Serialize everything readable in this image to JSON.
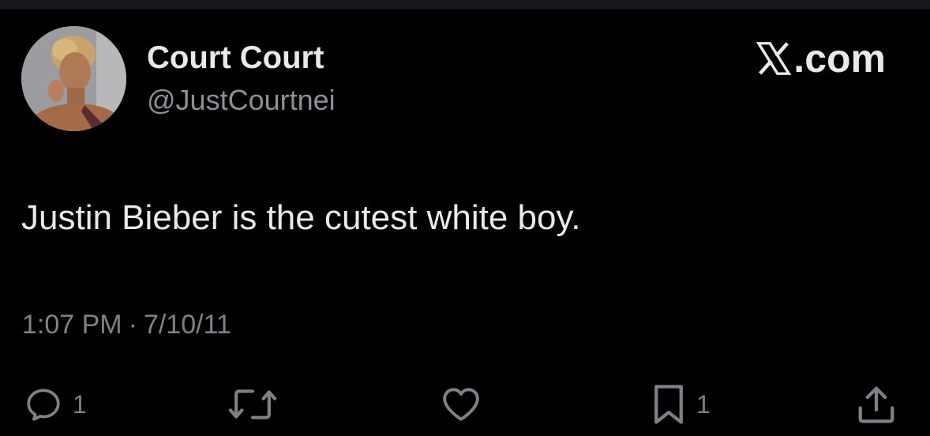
{
  "user": {
    "display_name": "Court Court",
    "handle": "@JustCourtnei",
    "avatar_icon": "profile-photo"
  },
  "brand": {
    "text": ".com",
    "icon": "x-logo-icon"
  },
  "tweet": {
    "text": "Justin Bieber is the cutest white boy.",
    "time": "1:07 PM",
    "separator": "·",
    "date": "7/10/11"
  },
  "actions": {
    "reply": {
      "icon": "reply-icon",
      "count": "1"
    },
    "retweet": {
      "icon": "retweet-icon",
      "count": ""
    },
    "like": {
      "icon": "heart-icon",
      "count": ""
    },
    "bookmark": {
      "icon": "bookmark-icon",
      "count": "1"
    },
    "share": {
      "icon": "share-icon"
    }
  },
  "colors": {
    "background": "#000000",
    "text_primary": "#e7e9ea",
    "text_secondary": "#7d8288"
  }
}
